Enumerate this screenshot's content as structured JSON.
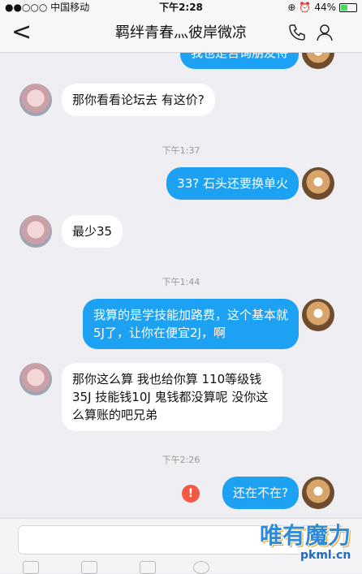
{
  "status": {
    "carrier": "●●○○○ 中国移动",
    "time": "下午2:28",
    "battery": "44%",
    "battery_level": 0.44
  },
  "nav": {
    "back": "<",
    "title": "羁绊青春灬彼岸微凉"
  },
  "messages": [
    {
      "text": "我也是咨询朋友待",
      "dir": "out"
    },
    {
      "text": "那你看看论坛去 有这价?",
      "dir": "in"
    },
    {
      "time": "下午1:37"
    },
    {
      "text": "33? 石头还要换单火",
      "dir": "out"
    },
    {
      "text": "最少35",
      "dir": "in"
    },
    {
      "time": "下午1:44"
    },
    {
      "text": "我算的是学技能加路费，这个基本就5J了，让你在便宜2J，啊",
      "dir": "out"
    },
    {
      "text": "那你这么算 我也给你算 110等级钱35J 技能钱10J 鬼钱都没算呢 没你这么算账的吧兄弟",
      "dir": "in"
    },
    {
      "time": "下午2:26"
    },
    {
      "text": "还在不在?",
      "dir": "out",
      "failed": true
    }
  ],
  "warn_icon": "!",
  "watermark": {
    "text": "唯有魔力",
    "url": "pkml.cn"
  }
}
